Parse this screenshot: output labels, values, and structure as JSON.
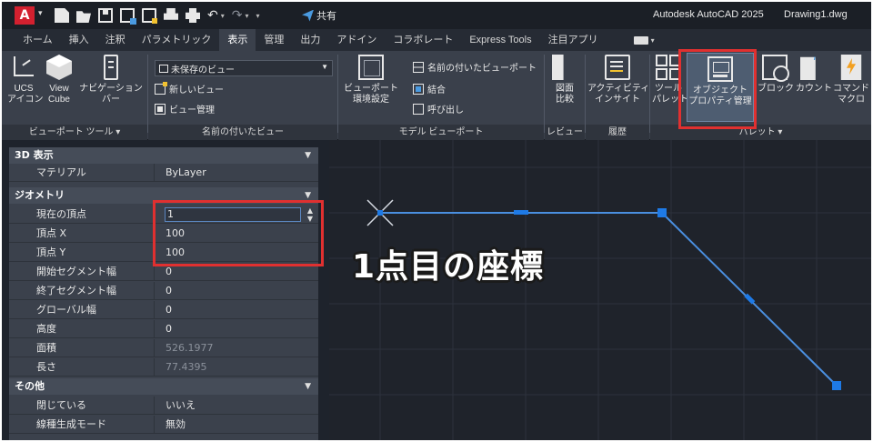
{
  "titlebar": {
    "logo": "A",
    "share_label": "共有",
    "app_title": "Autodesk AutoCAD 2025",
    "doc_title": "Drawing1.dwg"
  },
  "tabs": [
    "ホーム",
    "挿入",
    "注釈",
    "パラメトリック",
    "表示",
    "管理",
    "出力",
    "アドイン",
    "コラボレート",
    "Express Tools",
    "注目アプリ"
  ],
  "active_tab": "表示",
  "ribbon": {
    "viewport_tools": {
      "footer": "ビューポート ツール ▾",
      "ucs_icon": [
        "UCS",
        "アイコン"
      ],
      "view_cube": [
        "View",
        "Cube"
      ],
      "nav_bar": [
        "ナビゲーション",
        "バー"
      ]
    },
    "named_views": {
      "footer": "名前の付いたビュー",
      "dropdown_value": "未保存のビュー",
      "new_view": "新しいビュー",
      "view_manager": "ビュー管理"
    },
    "model_viewports": {
      "footer": "モデル ビューポート",
      "config": [
        "ビューポート",
        "環境設定"
      ],
      "named": "名前の付いたビューポート",
      "join": "結合",
      "restore": "呼び出し"
    },
    "review": {
      "footer": "レビュー",
      "compare": [
        "図面",
        "比較"
      ]
    },
    "history": {
      "footer": "履歴",
      "insight": [
        "アクティビティ",
        "インサイト"
      ]
    },
    "palettes": {
      "footer": "パレット ▾",
      "tool_palette": [
        "ツール",
        "パレット"
      ],
      "properties": [
        "オブジェクト",
        "プロパティ管理"
      ],
      "block": "ブロック",
      "count": "カウント",
      "command_macro": [
        "コマンド",
        "マクロ"
      ]
    }
  },
  "properties": {
    "sections": {
      "display3d": "3D 表示",
      "geometry": "ジオメトリ",
      "misc": "その他"
    },
    "rows": {
      "material": {
        "name": "マテリアル",
        "value": "ByLayer"
      },
      "current_vertex": {
        "name": "現在の頂点",
        "value": "1"
      },
      "vertex_x": {
        "name": "頂点 X",
        "value": "100"
      },
      "vertex_y": {
        "name": "頂点 Y",
        "value": "100"
      },
      "start_width": {
        "name": "開始セグメント幅",
        "value": "0"
      },
      "end_width": {
        "name": "終了セグメント幅",
        "value": "0"
      },
      "global_width": {
        "name": "グローバル幅",
        "value": "0"
      },
      "elevation": {
        "name": "高度",
        "value": "0"
      },
      "area": {
        "name": "面積",
        "value": "526.1977"
      },
      "length": {
        "name": "長さ",
        "value": "77.4395"
      },
      "closed": {
        "name": "閉じている",
        "value": "いいえ"
      },
      "linetype_gen": {
        "name": "線種生成モード",
        "value": "無効"
      }
    }
  },
  "annotation": {
    "callout": "1点目の座標"
  },
  "colors": {
    "highlight": "#e03030",
    "polyline": "#4a8fe0",
    "grip": "#1e7ae6"
  }
}
